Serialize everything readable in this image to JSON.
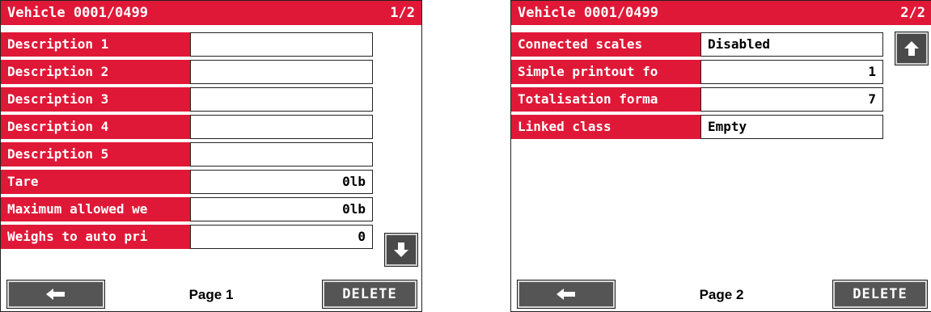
{
  "screens": [
    {
      "title": "Vehicle 0001/0499",
      "page_indicator": "1/2",
      "page_label": "Page 1",
      "delete_label": "DELETE",
      "fields": [
        {
          "label": "Description 1",
          "value": ""
        },
        {
          "label": "Description 2",
          "value": ""
        },
        {
          "label": "Description 3",
          "value": ""
        },
        {
          "label": "Description 4",
          "value": ""
        },
        {
          "label": "Description 5",
          "value": ""
        },
        {
          "label": "Tare",
          "value": "0lb"
        },
        {
          "label": "Maximum allowed we",
          "value": "0lb"
        },
        {
          "label": "Weighs to auto pri",
          "value": "0"
        }
      ]
    },
    {
      "title": "Vehicle 0001/0499",
      "page_indicator": "2/2",
      "page_label": "Page 2",
      "delete_label": "DELETE",
      "fields": [
        {
          "label": "Connected scales",
          "value": "Disabled"
        },
        {
          "label": "Simple printout fo",
          "value": "1"
        },
        {
          "label": "Totalisation forma",
          "value": "7"
        },
        {
          "label": "Linked class",
          "value": "Empty"
        }
      ]
    }
  ],
  "icons": {
    "scroll_down": "arrow-down-icon",
    "scroll_up": "arrow-up-icon",
    "back": "arrow-left-icon"
  },
  "colors": {
    "accent": "#e01837",
    "button": "#555555"
  }
}
